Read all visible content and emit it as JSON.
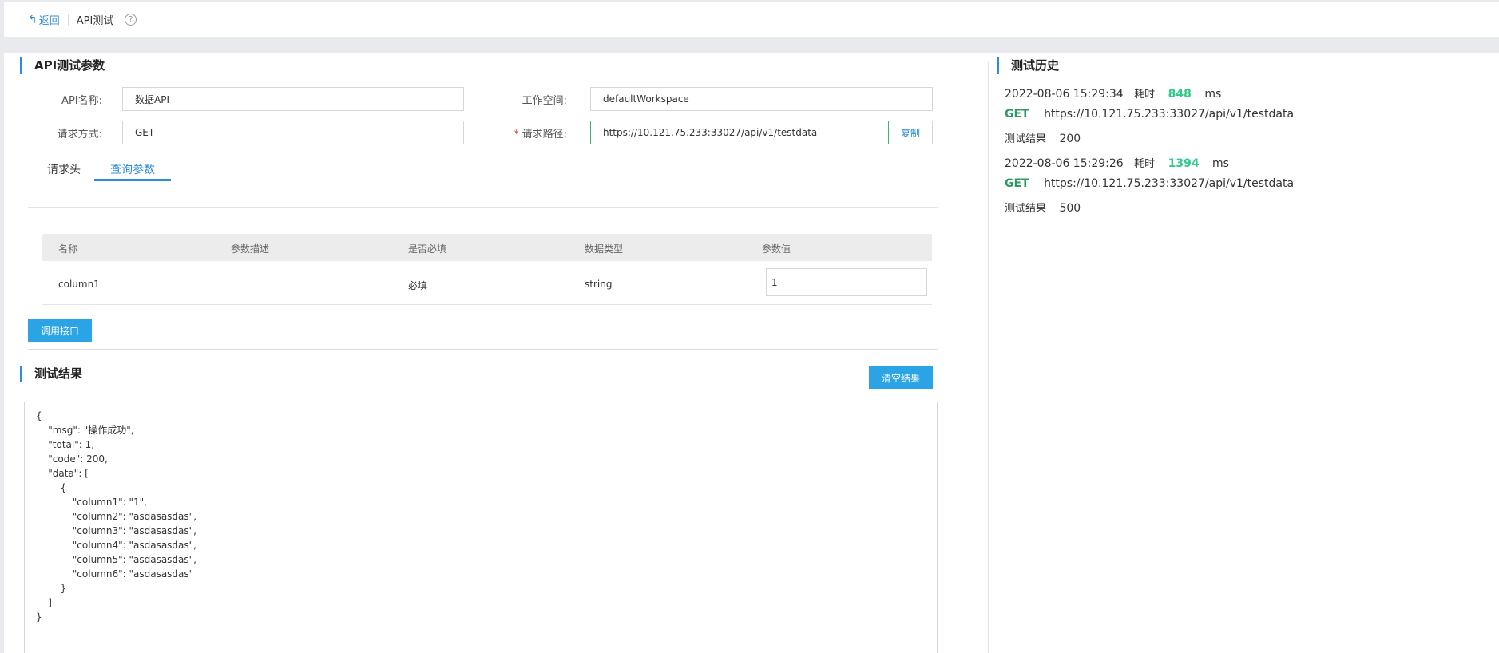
{
  "topbar": {
    "back_label": "返回",
    "back_arrow": "↰",
    "page_title": "API测试",
    "help_glyph": "?"
  },
  "params": {
    "section_title": "API测试参数",
    "api_name_label": "API名称:",
    "api_name_value": "数据API",
    "workspace_label": "工作空间:",
    "workspace_value": "defaultWorkspace",
    "method_label": "请求方式:",
    "method_value": "GET",
    "path_required_mark": "*",
    "path_label": "请求路径:",
    "path_value": "https://10.121.75.233:33027/api/v1/testdata",
    "copy_label": "复制"
  },
  "tabs": [
    {
      "label": "请求头"
    },
    {
      "label": "查询参数"
    }
  ],
  "query_table": {
    "headers": [
      "名称",
      "参数描述",
      "是否必填",
      "数据类型",
      "参数值"
    ],
    "rows": [
      {
        "name": "column1",
        "desc": "",
        "required": "必填",
        "type": "string",
        "value": "1"
      }
    ]
  },
  "call_button_label": "调用接口",
  "results": {
    "section_title": "测试结果",
    "clear_button_label": "清空结果",
    "body": "{\n    \"msg\": \"操作成功\",\n    \"total\": 1,\n    \"code\": 200,\n    \"data\": [\n        {\n            \"column1\": \"1\",\n            \"column2\": \"asdasasdas\",\n            \"column3\": \"asdasasdas\",\n            \"column4\": \"asdasasdas\",\n            \"column5\": \"asdasasdas\",\n            \"column6\": \"asdasasdas\"\n        }\n    ]\n}"
  },
  "history": {
    "section_title": "测试历史",
    "time_label": "耗时",
    "unit": "ms",
    "result_label": "测试结果",
    "items": [
      {
        "timestamp": "2022-08-06 15:29:34",
        "duration": "848",
        "method": "GET",
        "url": "https://10.121.75.233:33027/api/v1/testdata",
        "result": "200"
      },
      {
        "timestamp": "2022-08-06 15:29:26",
        "duration": "1394",
        "method": "GET",
        "url": "https://10.121.75.233:33027/api/v1/testdata",
        "result": "500"
      }
    ]
  },
  "colors": {
    "accent": "#2d8cd6",
    "button": "#2aa4e4",
    "duration": "#2ecc8a",
    "method": "#2e9a62",
    "focus_border": "#3fb86f"
  }
}
